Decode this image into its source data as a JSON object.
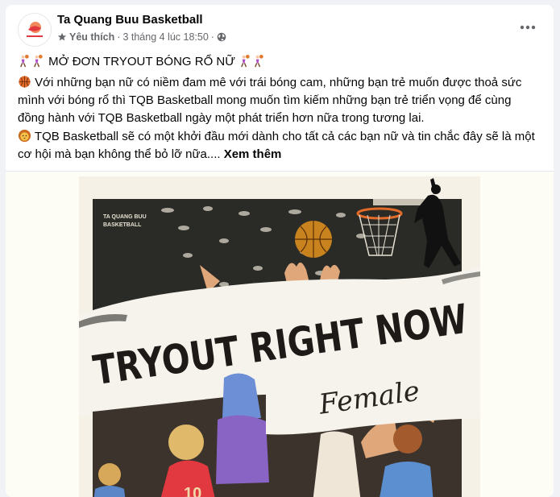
{
  "post": {
    "page_name": "Ta Quang Buu Basketball",
    "meta": {
      "favorite": "Yêu thích",
      "separator": "·",
      "date": "3 tháng 4 lúc 18:50",
      "separator2": "·"
    },
    "headline": "MỞ ĐƠN TRYOUT BÓNG RỔ NỮ",
    "paragraph1": "Với những bạn nữ có niềm đam mê với trái bóng cam, những bạn trẻ muốn được thoả sức mình với bóng rổ thì TQB Basketball mong muốn tìm kiếm những bạn trẻ triển vọng để cùng đồng hành với TQB Basketball ngày một phát triển hơn nữa trong tương lai.",
    "paragraph2": "TQB Basketball sẽ có một khởi đầu mới dành cho tất cả các bạn nữ và tin chắc đây sẽ là một cơ hội mà bạn không thể bỏ lỡ nữa....",
    "see_more": "Xem thêm"
  },
  "poster": {
    "logo_line1": "TA QUANG BUU",
    "logo_line2": "BASKETBALL",
    "title": "TRYOUT RIGHT NOW",
    "subtitle": "Female",
    "jersey_number": "10"
  },
  "icons": {
    "favorite": "star-icon",
    "privacy": "globe-icon",
    "more": "more-options-icon",
    "headline_emoji": "woman-basketball-emoji",
    "para1_emoji": "basketball-emoji",
    "para2_emoji": "lion-emoji"
  },
  "colors": {
    "text": "#050505",
    "secondary": "#65676b",
    "accent": "#e26b2a"
  }
}
